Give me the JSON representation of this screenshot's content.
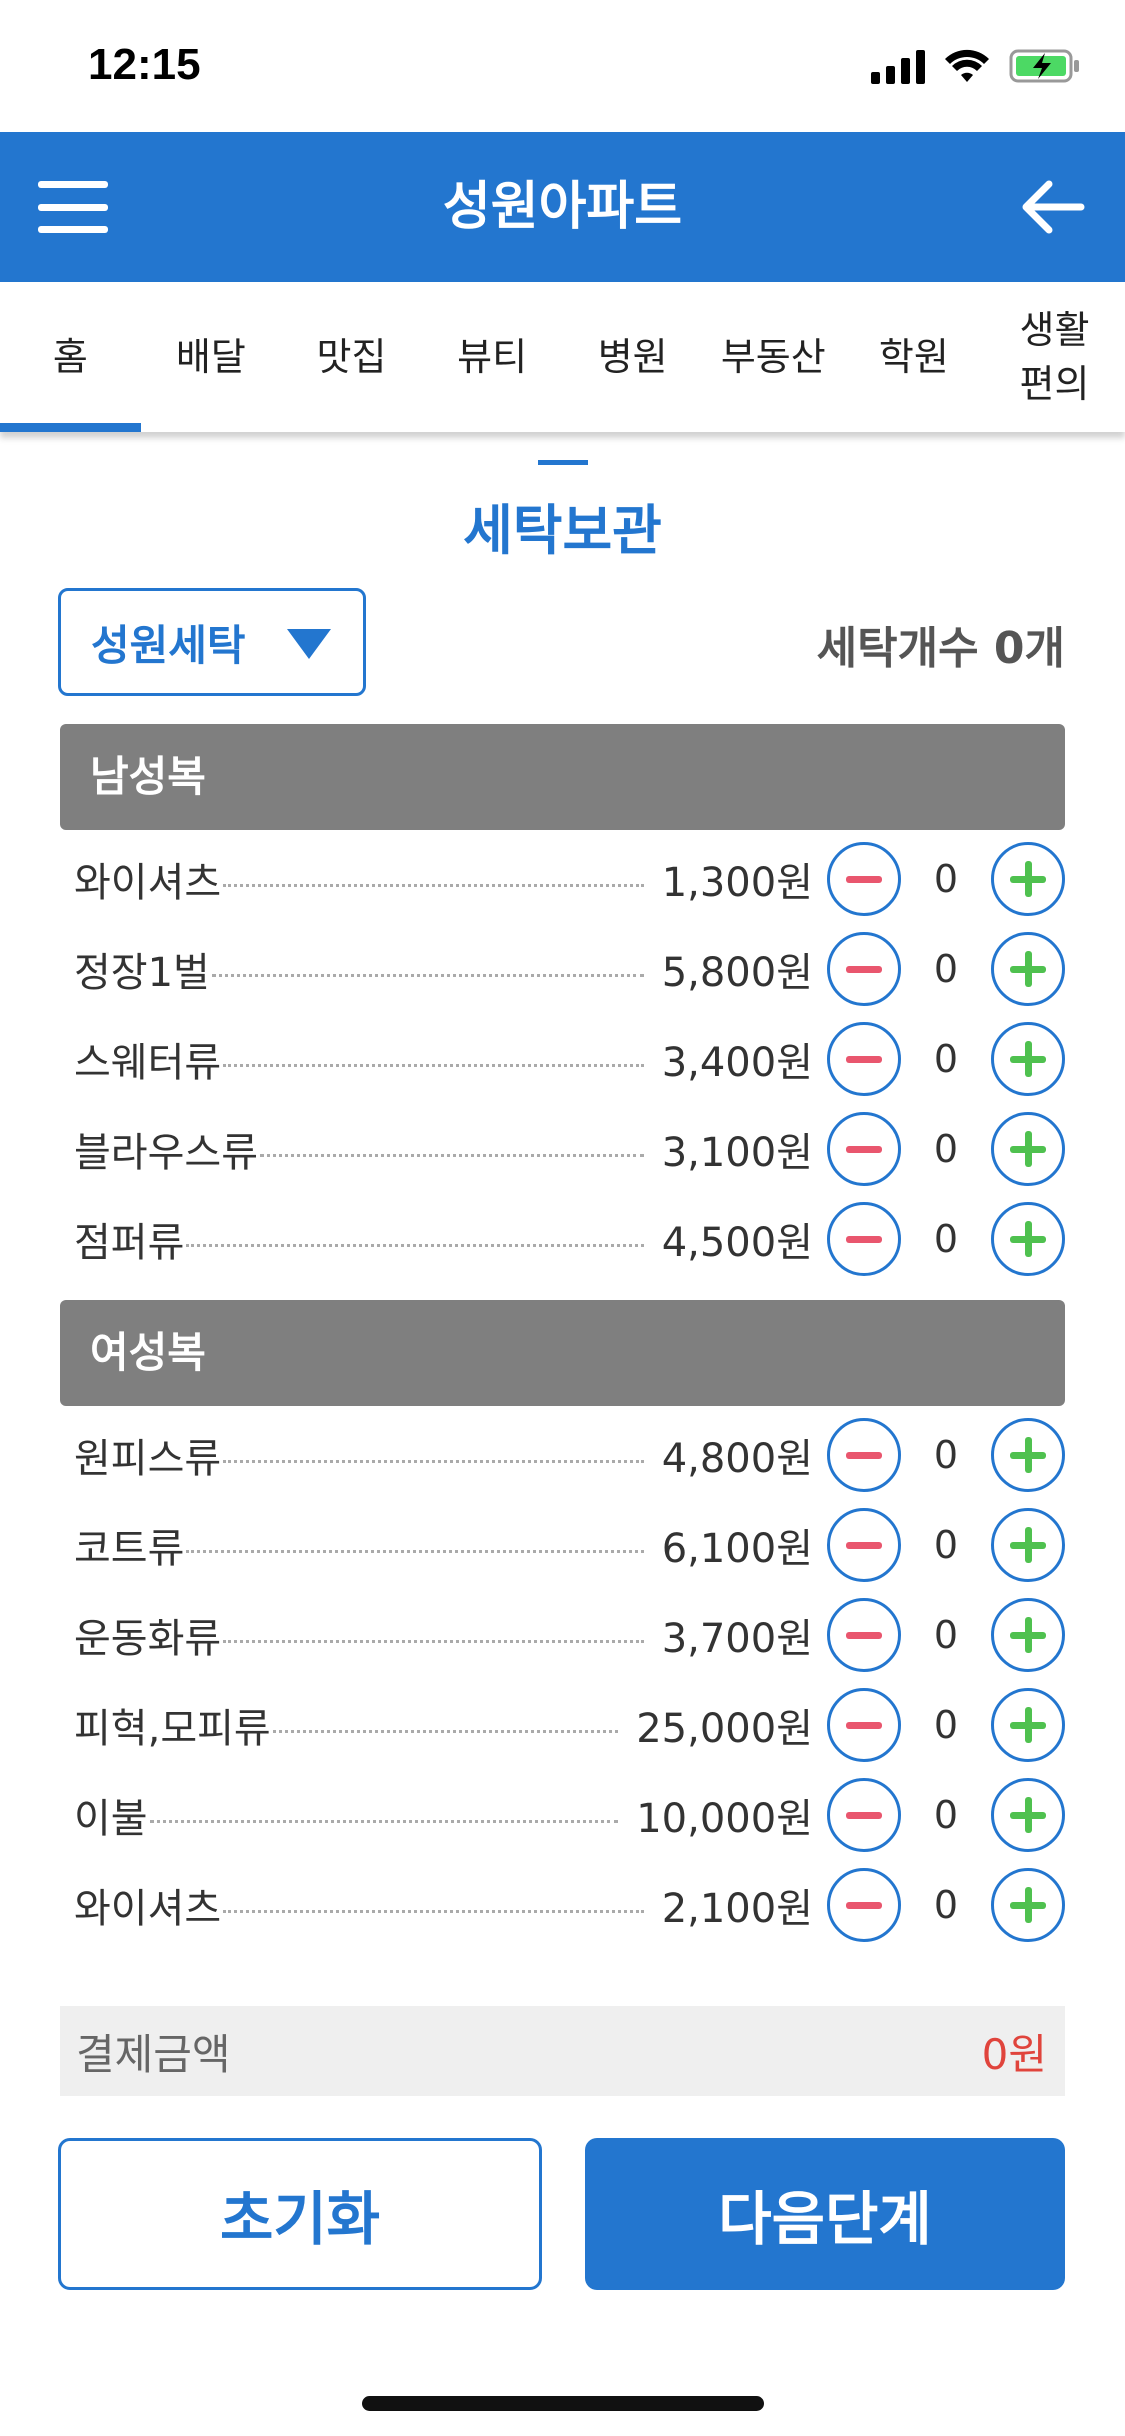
{
  "status_bar": {
    "time": "12:15"
  },
  "header": {
    "title": "성원아파트"
  },
  "tabs": [
    {
      "label": "홈",
      "active": true
    },
    {
      "label": "배달"
    },
    {
      "label": "맛집"
    },
    {
      "label": "뷰티"
    },
    {
      "label": "병원"
    },
    {
      "label": "부동산"
    },
    {
      "label": "학원"
    },
    {
      "label": "생활\n편의"
    }
  ],
  "section": {
    "title": "세탁보관"
  },
  "shop_select": {
    "label": "성원세탁"
  },
  "laundry_count": "세탁개수 0개",
  "categories": [
    {
      "title": "남성복",
      "items": [
        {
          "name": "와이셔츠",
          "price": "1,300원",
          "qty": "0"
        },
        {
          "name": "정장1벌",
          "price": "5,800원",
          "qty": "0"
        },
        {
          "name": "스웨터류",
          "price": "3,400원",
          "qty": "0"
        },
        {
          "name": "블라우스류",
          "price": "3,100원",
          "qty": "0"
        },
        {
          "name": "점퍼류",
          "price": "4,500원",
          "qty": "0"
        }
      ]
    },
    {
      "title": "여성복",
      "items": [
        {
          "name": "원피스류",
          "price": "4,800원",
          "qty": "0"
        },
        {
          "name": "코트류",
          "price": "6,100원",
          "qty": "0"
        },
        {
          "name": "운동화류",
          "price": "3,700원",
          "qty": "0"
        },
        {
          "name": "피혁,모피류",
          "price": "25,000원",
          "qty": "0"
        },
        {
          "name": "이불",
          "price": "10,000원",
          "qty": "0"
        },
        {
          "name": "와이셔츠",
          "price": "2,100원",
          "qty": "0"
        }
      ]
    }
  ],
  "total": {
    "label": "결제금액",
    "value": "0원"
  },
  "buttons": {
    "reset": "초기화",
    "next": "다음단계"
  },
  "colors": {
    "primary": "#2376cf",
    "minus": "#e9566e",
    "plus": "#4fc14f",
    "total": "#e0443c"
  }
}
